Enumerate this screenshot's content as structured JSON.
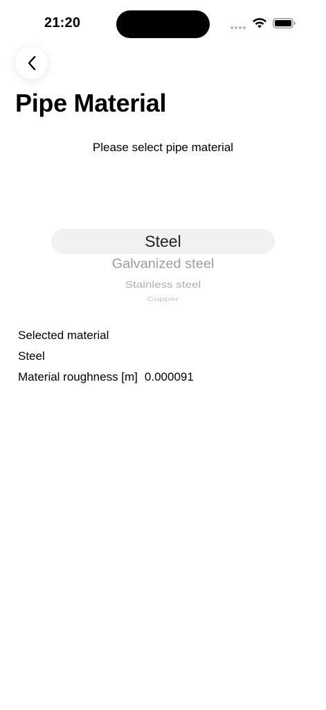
{
  "status_bar": {
    "time": "21:20",
    "icons": [
      "cellular-signal-icon",
      "wifi-icon",
      "battery-icon"
    ]
  },
  "navigation": {
    "back_icon": "chevron-left-icon"
  },
  "page": {
    "title": "Pipe Material",
    "prompt": "Please select pipe material"
  },
  "picker": {
    "selected": "Steel",
    "options_below": [
      "Galvanized steel",
      "Stainless steel",
      "Copper",
      ""
    ]
  },
  "info": {
    "selected_label": "Selected material",
    "selected_value": "Steel",
    "roughness_label": "Material roughness [m]",
    "roughness_value": "0.000091"
  },
  "colors": {
    "background": "#ffffff",
    "picker_highlight": "#f1f1f2",
    "text": "#000000"
  }
}
